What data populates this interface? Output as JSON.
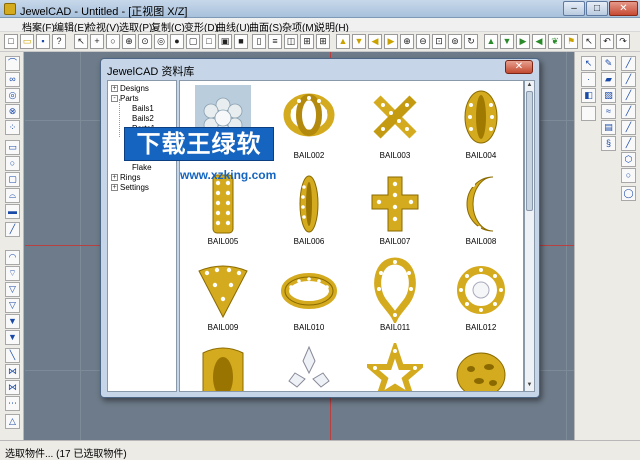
{
  "window": {
    "title": "JewelCAD - Untitled - [正视图 X/Z]",
    "controls": {
      "minimize": "–",
      "maximize": "□",
      "close": "✕"
    }
  },
  "menubar": {
    "items": [
      "档案(F)",
      "编辑(E)",
      "检视(V)",
      "选取(P)",
      "复制(C)",
      "变形(D)",
      "曲线(U)",
      "曲面(S)",
      "杂项(M)",
      "说明(H)"
    ]
  },
  "toolbar": {
    "icons": [
      "new",
      "open",
      "save",
      "help",
      "pointer",
      "cross",
      "circle",
      "grid-circle",
      "dot-circle",
      "ring-circle",
      "solid-circle",
      "frame-square",
      "square",
      "bold-square",
      "filled-square",
      "page",
      "page-lines",
      "vertical-split",
      "quad-split",
      "grid",
      "triangle-up",
      "triangle-down",
      "triangle-left",
      "triangle-right",
      "zoom-in",
      "zoom-out",
      "zoom-box",
      "zoom-fit",
      "rotate",
      "arrow-up",
      "arrow-down",
      "arrow-right",
      "arrow-left",
      "leaf",
      "flag",
      "refresh"
    ]
  },
  "dialog": {
    "title": "JewelCAD 资料库",
    "close": "✕",
    "tree": [
      {
        "label": "Designs",
        "toggle": "+"
      },
      {
        "label": "Parts",
        "toggle": "-"
      },
      {
        "label": "Bails1"
      },
      {
        "label": "Bails2"
      },
      {
        "label": "Parts1"
      },
      {
        "label": "Flake"
      },
      {
        "label": "Rings",
        "toggle": "+"
      },
      {
        "label": "Settings",
        "toggle": "+"
      }
    ],
    "items": [
      {
        "label": ""
      },
      {
        "label": "BAIL002"
      },
      {
        "label": "BAIL003"
      },
      {
        "label": "BAIL004"
      },
      {
        "label": "BAIL005"
      },
      {
        "label": "BAIL006"
      },
      {
        "label": "BAIL007"
      },
      {
        "label": "BAIL008"
      },
      {
        "label": "BAIL009"
      },
      {
        "label": "BAIL010"
      },
      {
        "label": "BAIL011"
      },
      {
        "label": "BAIL012"
      },
      {
        "label": ""
      },
      {
        "label": ""
      },
      {
        "label": ""
      },
      {
        "label": ""
      }
    ]
  },
  "watermark": {
    "text": "下载王绿软",
    "url": "www.xzking.com"
  },
  "status": {
    "text": "选取物件... (17 已选取物件)"
  },
  "colors": {
    "gold": "#d4aa1e",
    "canvas": "#6e7b8a",
    "axis": "#b84040",
    "watermark": "#1565c0"
  }
}
